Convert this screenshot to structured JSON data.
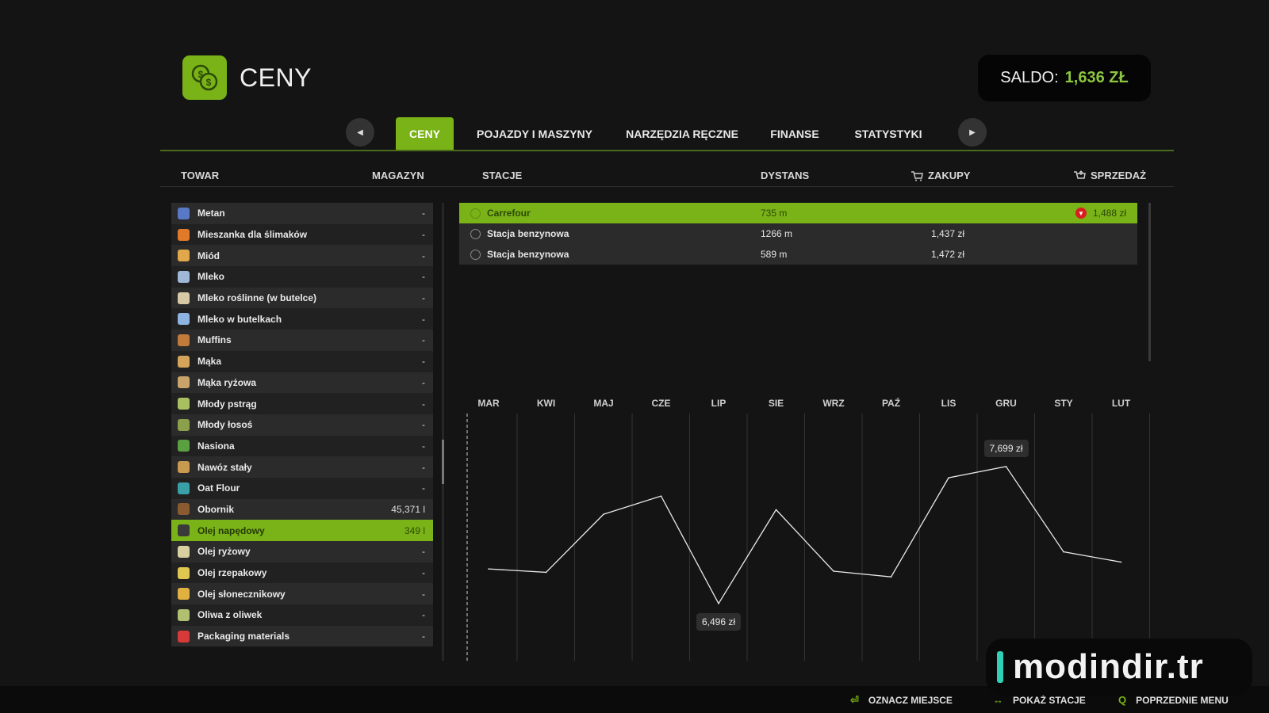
{
  "header": {
    "title": "CENY",
    "saldo_label": "SALDO:",
    "saldo_value": "1,636 ZŁ"
  },
  "tabs": [
    "CENY",
    "POJAZDY I MASZYNY",
    "NARZĘDZIA RĘCZNE",
    "FINANSE",
    "STATYSTYKI"
  ],
  "columns": {
    "goods": "TOWAR",
    "storage": "MAGAZYN",
    "stations": "STACJE",
    "distance": "DYSTANS",
    "buy": "ZAKUPY",
    "sell": "SPRZEDAŻ"
  },
  "goods": [
    {
      "name": "Metan",
      "qty": "-",
      "icon_color": "#5a78c8"
    },
    {
      "name": "Mieszanka dla ślimaków",
      "qty": "-",
      "icon_color": "#e07a2a"
    },
    {
      "name": "Miód",
      "qty": "-",
      "icon_color": "#e0a84a"
    },
    {
      "name": "Mleko",
      "qty": "-",
      "icon_color": "#9fb8d8"
    },
    {
      "name": "Mleko roślinne (w butelce)",
      "qty": "-",
      "icon_color": "#d8c9a6"
    },
    {
      "name": "Mleko w butelkach",
      "qty": "-",
      "icon_color": "#8db3e0"
    },
    {
      "name": "Muffins",
      "qty": "-",
      "icon_color": "#c27a3a"
    },
    {
      "name": "Mąka",
      "qty": "-",
      "icon_color": "#d4a45a"
    },
    {
      "name": "Mąka ryżowa",
      "qty": "-",
      "icon_color": "#c8a46a"
    },
    {
      "name": "Młody pstrąg",
      "qty": "-",
      "icon_color": "#a8c060"
    },
    {
      "name": "Młody łosoś",
      "qty": "-",
      "icon_color": "#8aa04a"
    },
    {
      "name": "Nasiona",
      "qty": "-",
      "icon_color": "#5aa040"
    },
    {
      "name": "Nawóz stały",
      "qty": "-",
      "icon_color": "#c89a50"
    },
    {
      "name": "Oat Flour",
      "qty": "-",
      "icon_color": "#3aa0a8"
    },
    {
      "name": "Obornik",
      "qty": "45,371 l",
      "icon_color": "#8a5a30"
    },
    {
      "name": "Olej napędowy",
      "qty": "349 l",
      "icon_color": "#3a3a3a",
      "selected": true
    },
    {
      "name": "Olej ryżowy",
      "qty": "-",
      "icon_color": "#d8d0a0"
    },
    {
      "name": "Olej rzepakowy",
      "qty": "-",
      "icon_color": "#e0c850"
    },
    {
      "name": "Olej słonecznikowy",
      "qty": "-",
      "icon_color": "#e0b040"
    },
    {
      "name": "Oliwa z oliwek",
      "qty": "-",
      "icon_color": "#b0c070"
    },
    {
      "name": "Packaging materials",
      "qty": "-",
      "icon_color": "#d83a3a"
    }
  ],
  "stations": [
    {
      "name": "Carrefour",
      "distance": "735 m",
      "buy": "",
      "sell": "1,488 zł",
      "selected": true
    },
    {
      "name": "Stacja benzynowa",
      "distance": "1266 m",
      "buy": "1,437 zł",
      "sell": ""
    },
    {
      "name": "Stacja benzynowa",
      "distance": "589 m",
      "buy": "1,472 zł",
      "sell": ""
    }
  ],
  "chart_data": {
    "type": "line",
    "categories": [
      "MAR",
      "KWI",
      "MAJ",
      "CZE",
      "LIP",
      "SIE",
      "WRZ",
      "PAŹ",
      "LIS",
      "GRU",
      "STY",
      "LUT"
    ],
    "series": [
      {
        "values": [
          6800,
          6770,
          7280,
          7440,
          6496,
          7320,
          6780,
          6730,
          7600,
          7699,
          6950,
          6860
        ]
      }
    ],
    "annotations": [
      {
        "label": "7,699 zł"
      },
      {
        "label": "6,496 zł"
      }
    ],
    "ylim": [
      6300,
      7900
    ],
    "grid": true
  },
  "footer": [
    {
      "key": "⏎",
      "label": "OZNACZ MIEJSCE"
    },
    {
      "key": "↔",
      "label": "POKAŻ STACJE"
    },
    {
      "key": "Q",
      "label": "POPRZEDNIE MENU"
    }
  ],
  "watermark": "modindir.tr"
}
